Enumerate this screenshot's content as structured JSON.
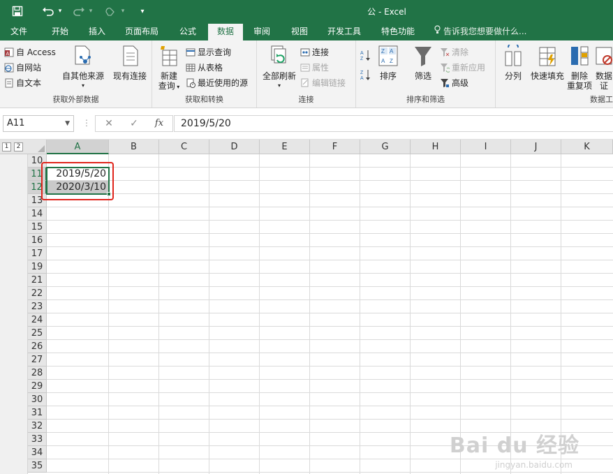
{
  "window": {
    "title": "公 - Excel"
  },
  "titlebar": {
    "qat_more": "▾"
  },
  "menu": {
    "tabs": [
      {
        "label": "文件"
      },
      {
        "label": "开始"
      },
      {
        "label": "插入"
      },
      {
        "label": "页面布局"
      },
      {
        "label": "公式"
      },
      {
        "label": "数据"
      },
      {
        "label": "审阅"
      },
      {
        "label": "视图"
      },
      {
        "label": "开发工具"
      },
      {
        "label": "特色功能"
      }
    ],
    "active": "数据",
    "tellme": "告诉我您想要做什么..."
  },
  "ribbon": {
    "get_external": {
      "label": "获取外部数据",
      "access": "自 Access",
      "web": "自网站",
      "text": "自文本",
      "other_sources": "自其他来源",
      "existing": "现有连接"
    },
    "get_transform": {
      "label": "获取和转换",
      "new_query_1": "新建",
      "new_query_2": "查询",
      "show_queries": "显示查询",
      "from_table": "从表格",
      "recent_sources": "最近使用的源"
    },
    "connections": {
      "label": "连接",
      "refresh_all": "全部刷新",
      "connections": "连接",
      "properties": "属性",
      "edit_links": "编辑链接"
    },
    "sort_filter": {
      "label": "排序和筛选",
      "sort": "排序",
      "filter": "筛选",
      "clear": "清除",
      "reapply": "重新应用",
      "advanced": "高级"
    },
    "data_tools": {
      "label": "数据工",
      "text_to_columns": "分列",
      "flash_fill": "快速填充",
      "remove_dup_1": "删除",
      "remove_dup_2": "重复项",
      "validation_1": "数据",
      "validation_2": "证"
    }
  },
  "formula_bar": {
    "name_box": "A11",
    "cancel": "✕",
    "enter": "✓",
    "fx": "fx",
    "content": "2019/5/20"
  },
  "sheet": {
    "outline_levels": [
      "1",
      "2"
    ],
    "columns": [
      "A",
      "B",
      "C",
      "D",
      "E",
      "F",
      "G",
      "H",
      "I",
      "J",
      "K"
    ],
    "rows": [
      "10",
      "11",
      "12",
      "13",
      "14",
      "15",
      "16",
      "17",
      "19",
      "21",
      "22",
      "23",
      "24",
      "25",
      "26",
      "27",
      "28",
      "29",
      "30",
      "31",
      "32",
      "33",
      "34",
      "35"
    ],
    "selected_column": "A",
    "cells": {
      "A11": "2019/5/20",
      "A12": "2020/3/10"
    }
  },
  "watermark": {
    "brand": "Bai du 经验",
    "url": "jingyan.baidu.com"
  },
  "colors": {
    "accent": "#217346",
    "highlight": "#e0241b"
  }
}
